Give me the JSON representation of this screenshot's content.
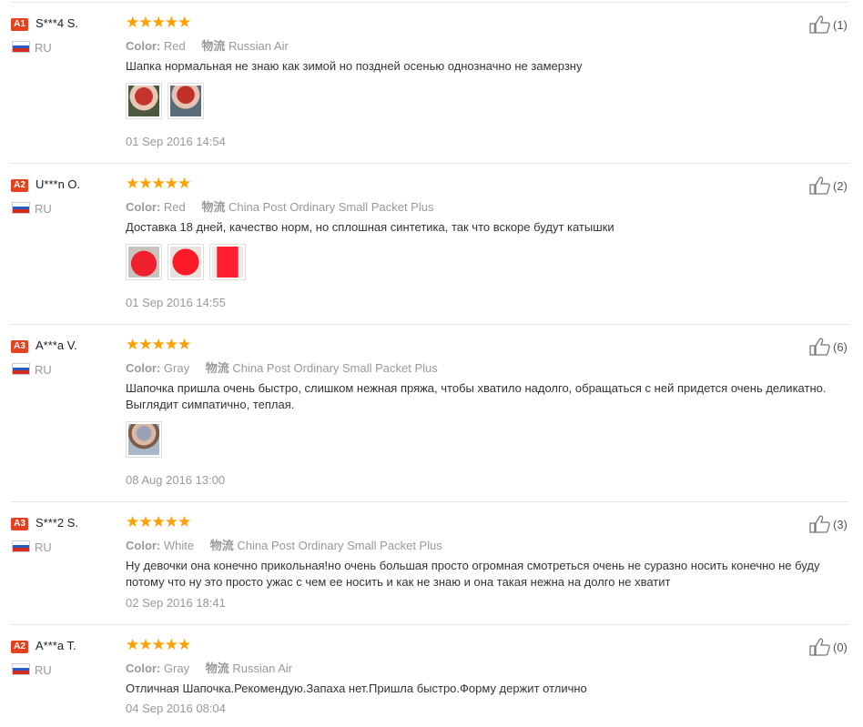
{
  "labels": {
    "color": "Color:",
    "logistics": "物流"
  },
  "colors": {
    "star": "#ffa000",
    "badge": "#e4411e"
  },
  "reviews": [
    {
      "badge": "A1",
      "name": "S***4 S.",
      "country": "RU",
      "rating": "★★★★★",
      "color": "Red",
      "shipping": "Russian Air",
      "text": "Шапка нормальная не знаю как зимой но поздней осенью однозначно не замерзну",
      "photos": [
        "red-hat-woman-photo-1",
        "red-hat-woman-photo-2"
      ],
      "date": "01 Sep 2016 14:54",
      "helpful": "(1)"
    },
    {
      "badge": "A2",
      "name": "U***n O.",
      "country": "RU",
      "rating": "★★★★★",
      "color": "Red",
      "shipping": "China Post Ordinary Small Packet Plus",
      "text": "Доставка 18 дней, качество норм, но сплошная синтетика, так что вскоре будут катышки",
      "photos": [
        "red-hat-photo-1",
        "red-hat-photo-2",
        "red-hat-photo-3"
      ],
      "date": "01 Sep 2016 14:55",
      "helpful": "(2)"
    },
    {
      "badge": "A3",
      "name": "A***a V.",
      "country": "RU",
      "rating": "★★★★★",
      "color": "Gray",
      "shipping": "China Post Ordinary Small Packet Plus",
      "text": "Шапочка пришла очень быстро, слишком нежная пряжа, чтобы хватило надолго, обращаться с ней придется очень деликатно. Выглядит симпатично, теплая.",
      "photos": [
        "gray-hat-woman-photo"
      ],
      "date": "08 Aug 2016 13:00",
      "helpful": "(6)"
    },
    {
      "badge": "A3",
      "name": "S***2 S.",
      "country": "RU",
      "rating": "★★★★★",
      "color": "White",
      "shipping": "China Post Ordinary Small Packet Plus",
      "text": "Ну девочки она конечно прикольная!но очень большая просто огромная смотреться очень не суразно носить конечно не буду потому что ну это просто ужас с чем ее носить и как не знаю и она такая нежна на долго не хватит",
      "photos": [],
      "date": "02 Sep 2016 18:41",
      "helpful": "(3)"
    },
    {
      "badge": "A2",
      "name": "A***a T.",
      "country": "RU",
      "rating": "★★★★★",
      "color": "Gray",
      "shipping": "Russian Air",
      "text": "Отличная Шапочка.Рекомендую.Запаха нет.Пришла быстро.Форму держит отлично",
      "photos": [],
      "date": "04 Sep 2016 08:04",
      "helpful": "(0)"
    }
  ]
}
